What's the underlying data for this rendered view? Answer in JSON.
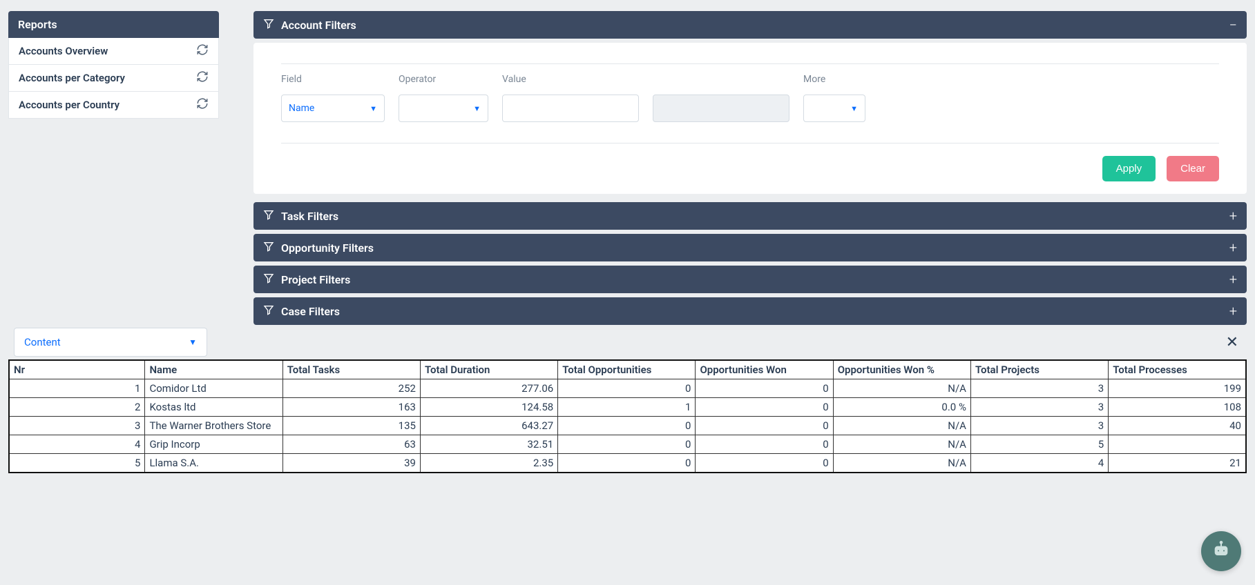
{
  "sidebar": {
    "title": "Reports",
    "items": [
      {
        "label": "Accounts Overview"
      },
      {
        "label": "Accounts per Category"
      },
      {
        "label": "Accounts per Country"
      }
    ]
  },
  "filters": {
    "account": {
      "title": "Account Filters",
      "expanded": true,
      "labels": {
        "field": "Field",
        "operator": "Operator",
        "value": "Value",
        "more": "More"
      },
      "row": {
        "field_value": "Name"
      },
      "buttons": {
        "apply": "Apply",
        "clear": "Clear"
      }
    },
    "task": {
      "title": "Task Filters",
      "expanded": false
    },
    "opportunity": {
      "title": "Opportunity Filters",
      "expanded": false
    },
    "project": {
      "title": "Project Filters",
      "expanded": false
    },
    "case": {
      "title": "Case Filters",
      "expanded": false
    }
  },
  "content_dropdown": {
    "value": "Content"
  },
  "table": {
    "headers": {
      "nr": "Nr",
      "name": "Name",
      "total_tasks": "Total Tasks",
      "total_duration": "Total Duration",
      "total_opps": "Total Opportunities",
      "opps_won": "Opportunities Won",
      "opps_won_pct": "Opportunities Won %",
      "total_projects": "Total Projects",
      "total_processes": "Total Processes"
    },
    "rows": [
      {
        "nr": "1",
        "name": "Comidor Ltd",
        "tasks": "252",
        "duration": "277.06",
        "opps": "0",
        "won": "0",
        "wonpct": "N/A",
        "projects": "3",
        "processes": "199"
      },
      {
        "nr": "2",
        "name": "Kostas ltd",
        "tasks": "163",
        "duration": "124.58",
        "opps": "1",
        "won": "0",
        "wonpct": "0.0 %",
        "projects": "3",
        "processes": "108"
      },
      {
        "nr": "3",
        "name": "The Warner Brothers Store",
        "tasks": "135",
        "duration": "643.27",
        "opps": "0",
        "won": "0",
        "wonpct": "N/A",
        "projects": "3",
        "processes": "40"
      },
      {
        "nr": "4",
        "name": "Grip Incorp",
        "tasks": "63",
        "duration": "32.51",
        "opps": "0",
        "won": "0",
        "wonpct": "N/A",
        "projects": "5",
        "processes": ""
      },
      {
        "nr": "5",
        "name": "Llama S.A.",
        "tasks": "39",
        "duration": "2.35",
        "opps": "0",
        "won": "0",
        "wonpct": "N/A",
        "projects": "4",
        "processes": "21"
      }
    ]
  }
}
